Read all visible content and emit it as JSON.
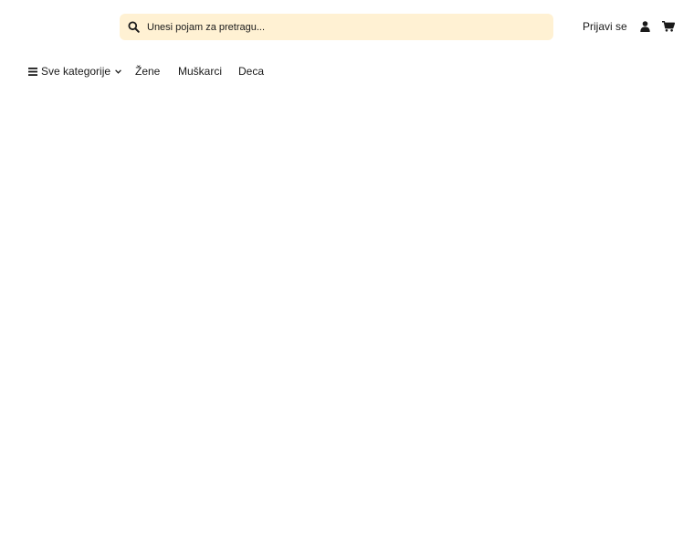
{
  "header": {
    "search": {
      "placeholder": "Unesi pojam za pretragu...",
      "icon": "search-icon"
    },
    "login_label": "Prijavi se",
    "user_icon": "user-icon",
    "cart_icon": "cart-icon"
  },
  "nav": {
    "all_categories": "Sve kategorije",
    "items": [
      {
        "label": "Žene"
      },
      {
        "label": "Muškarci"
      },
      {
        "label": "Deca"
      }
    ]
  },
  "colors": {
    "search_bg": "#fff1d3",
    "text": "#1a1a1a"
  }
}
